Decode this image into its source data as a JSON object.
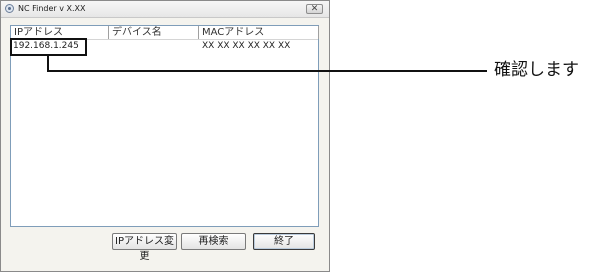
{
  "window": {
    "title": "NC Finder v X.XX",
    "close_glyph": "✕",
    "app_icon": "nc-finder-app-icon"
  },
  "list": {
    "columns": [
      "IPアドレス",
      "デバイス名",
      "MACアドレス"
    ],
    "rows": [
      {
        "ip": "192.168.1.245",
        "device": "",
        "mac": "XX XX XX XX XX XX"
      }
    ]
  },
  "buttons": {
    "change_ip": "IPアドレス変更",
    "search_again": "再検索",
    "exit": "終了"
  },
  "annotation": {
    "callout": "確認します"
  }
}
